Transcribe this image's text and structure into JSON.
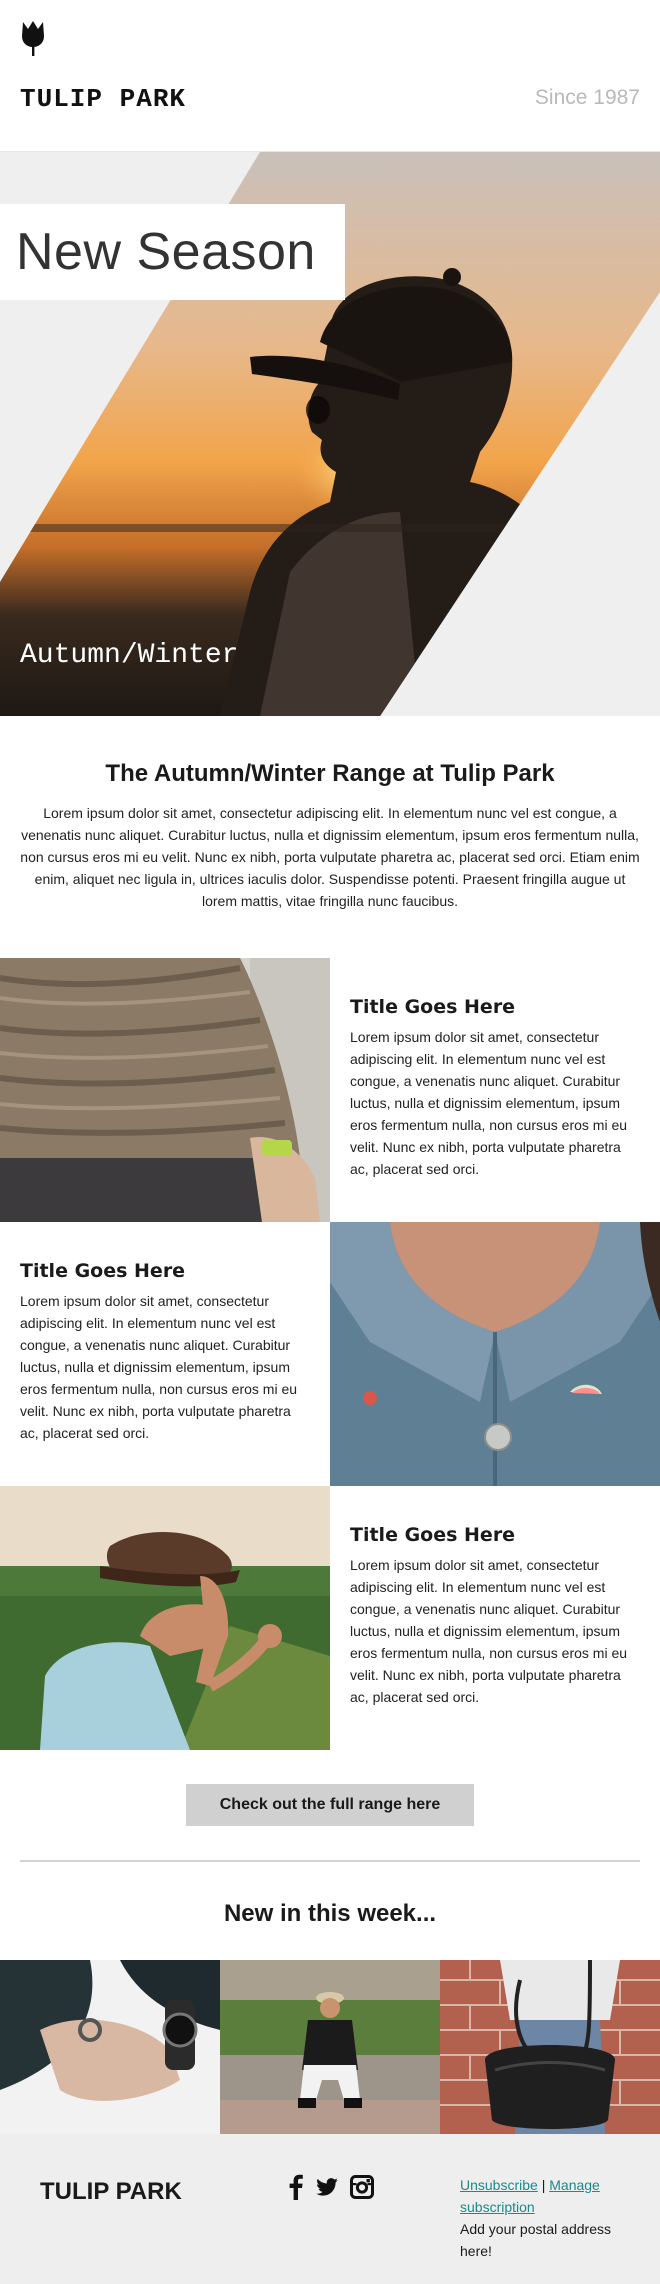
{
  "header": {
    "brand": "TULIP PARK",
    "since": "Since 1987",
    "logo_icon": "tulip-icon"
  },
  "hero": {
    "title": "New Season",
    "subtitle": "Autumn/Winter"
  },
  "intro": {
    "heading": "The Autumn/Winter Range at Tulip Park",
    "body": "Lorem ipsum dolor sit amet, consectetur adipiscing elit. In elementum nunc vel est congue, a venenatis nunc aliquet. Curabitur luctus, nulla et dignissim elementum, ipsum eros fermentum nulla, non cursus eros mi eu velit. Nunc ex nibh, porta vulputate pharetra ac, placerat sed orci. Etiam enim enim, aliquet nec ligula in, ultrices iaculis dolor. Suspendisse potenti. Praesent fringilla augue ut lorem mattis, vitae fringilla nunc faucibus."
  },
  "features": [
    {
      "title": "Title Goes Here",
      "body": "Lorem ipsum dolor sit amet, consectetur adipiscing elit. In elementum nunc vel est congue, a venenatis nunc aliquet. Curabitur luctus, nulla et dignissim elementum, ipsum eros fermentum nulla, non cursus eros mi eu velit. Nunc ex nibh, porta vulputate pharetra ac, placerat sed orci."
    },
    {
      "title": "Title Goes Here",
      "body": "Lorem ipsum dolor sit amet, consectetur adipiscing elit. In elementum nunc vel est congue, a venenatis nunc aliquet. Curabitur luctus, nulla et dignissim elementum, ipsum eros fermentum nulla, non cursus eros mi eu velit. Nunc ex nibh, porta vulputate pharetra ac, placerat sed orci."
    },
    {
      "title": "Title Goes Here",
      "body": "Lorem ipsum dolor sit amet, consectetur adipiscing elit. In elementum nunc vel est congue, a venenatis nunc aliquet. Curabitur luctus, nulla et dignissim elementum, ipsum eros fermentum nulla, non cursus eros mi eu velit. Nunc ex nibh, porta vulputate pharetra ac, placerat sed orci."
    }
  ],
  "cta": {
    "label": "Check out the full range here"
  },
  "new_section": {
    "title": "New in this week..."
  },
  "footer": {
    "brand": "TULIP PARK",
    "social_icons": [
      "facebook-icon",
      "twitter-icon",
      "instagram-icon"
    ],
    "unsubscribe": "Unsubscribe",
    "separator": "|",
    "manage": "Manage subscription",
    "address": "Add your postal address here!"
  },
  "colors": {
    "link": "#1a8a8a",
    "cta_bg": "#d0d0d0",
    "footer_bg": "#eeeeee",
    "hero_bg": "#efefef",
    "since_text": "#b9b9b9"
  }
}
